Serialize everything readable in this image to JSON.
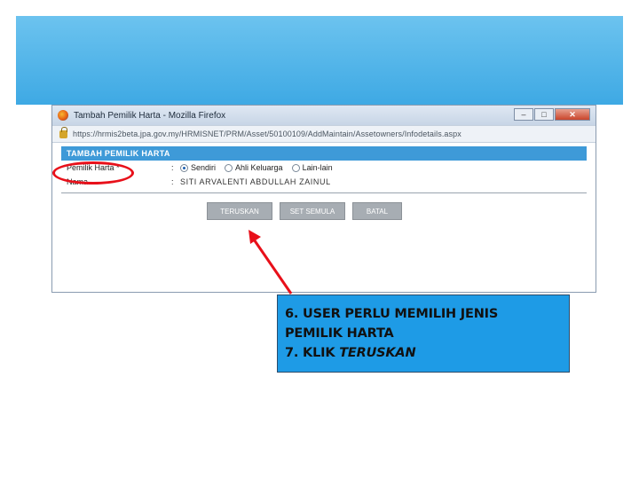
{
  "window": {
    "title": "Tambah Pemilik Harta - Mozilla Firefox",
    "url": "https://hrmis2beta.jpa.gov.my/HRMISNET/PRM/Asset/50100109/AddMaintain/Assetowners/Infodetails.aspx"
  },
  "form": {
    "header": "TAMBAH PEMILIK HARTA",
    "owner_label": "Pemilik Harta *",
    "owner_options": [
      "Sendiri",
      "Ahli Keluarga",
      "Lain-lain"
    ],
    "owner_selected": "Sendiri",
    "name_label": "Nama",
    "name_value": "SITI ARVALENTI ABDULLAH ZAINUL",
    "buttons": {
      "continue": "TERUSKAN",
      "reset": "SET SEMULA",
      "cancel": "BATAL"
    }
  },
  "callout": {
    "line1": "6. USER PERLU MEMILIH JENIS",
    "line2": "PEMILIK HARTA",
    "line3_prefix": "7. KLIK ",
    "line3_emph": "TERUSKAN"
  },
  "colors": {
    "annotation": "#e8101a",
    "callout_bg": "#1e9be6",
    "header_blue": "#3e9ad8"
  }
}
